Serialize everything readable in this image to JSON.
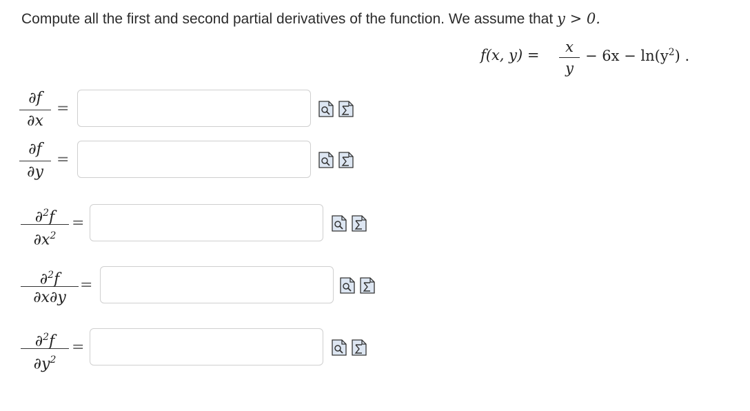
{
  "prompt": {
    "text": "Compute all the first and second partial derivatives of the function. We assume that ",
    "condition": "y > 0."
  },
  "function": {
    "lhs": "f(x, y) =",
    "numerator": "x",
    "denominator": "y",
    "rhs_a": "− 6x − ln(y",
    "rhs_exp": "2",
    "rhs_b": ") ."
  },
  "derivatives": [
    {
      "num": "∂f",
      "num_sup": "",
      "num_rest": "",
      "den": "∂x",
      "den_sup": "",
      "value": ""
    },
    {
      "num": "∂f",
      "num_sup": "",
      "num_rest": "",
      "den": "∂y",
      "den_sup": "",
      "value": ""
    },
    {
      "num": "∂",
      "num_sup": "2",
      "num_rest": "f",
      "den": "∂x",
      "den_sup": "2",
      "value": ""
    },
    {
      "num": "∂",
      "num_sup": "2",
      "num_rest": "f",
      "den": "∂x∂y",
      "den_sup": "",
      "value": ""
    },
    {
      "num": "∂",
      "num_sup": "2",
      "num_rest": "f",
      "den": "∂y",
      "den_sup": "2",
      "value": ""
    }
  ],
  "equals_sign": "=",
  "icons": {
    "preview": "preview-icon",
    "equation_editor": "equation-editor-icon"
  }
}
